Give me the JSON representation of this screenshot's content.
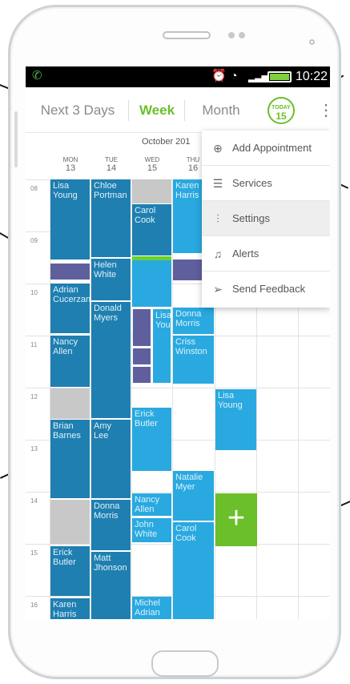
{
  "status_bar": {
    "time": "10:22"
  },
  "tabs": [
    {
      "label": "Next 3 Days"
    },
    {
      "label": "Week"
    },
    {
      "label": "Month"
    }
  ],
  "today_badge": {
    "label": "TODAY",
    "day": "15"
  },
  "calendar": {
    "month_label": "October 201",
    "days": [
      {
        "dow": "MON",
        "num": "13"
      },
      {
        "dow": "TUE",
        "num": "14"
      },
      {
        "dow": "WED",
        "num": "15"
      },
      {
        "dow": "THU",
        "num": "16"
      }
    ],
    "hours": [
      "08",
      "09",
      "10",
      "11",
      "12",
      "13",
      "14",
      "15",
      "16"
    ],
    "events": {
      "lisa_young_mon": "Lisa Young",
      "adrian": "Adrian Cucerzan",
      "nancy_allen_mon": "Nancy Allen",
      "brian": "Brian Barnes",
      "erick_mon": "Erick Butler",
      "karen_mon": "Karen Harris",
      "chloe": "Chloe Portman",
      "helen": "Helen White",
      "donald": "Donald Myers",
      "amy": "Amy Lee",
      "donna_tue": "Donna Morris",
      "matt": "Matt Jhonson",
      "carol_wed": "Carol Cook",
      "lisa_young_wed": "Lisa Young",
      "erick_wed": "Erick Butler",
      "nancy_wed": "Nancy Allen",
      "john": "John White",
      "michel": "Michel Adrian",
      "karen_thu": "Karen Harris",
      "donna_thu": "Donna Morris",
      "criss": "Criss Winston",
      "natalie": "Natalie Myer",
      "carol_thu": "Carol Cook",
      "lisa_young_fri": "Lisa Young"
    }
  },
  "overflow_menu": [
    {
      "icon": "plus-circle-icon",
      "label": "Add Appointment"
    },
    {
      "icon": "list-icon",
      "label": "Services"
    },
    {
      "icon": "sliders-icon",
      "label": "Settings"
    },
    {
      "icon": "bell-icon",
      "label": "Alerts"
    },
    {
      "icon": "send-icon",
      "label": "Send Feedback"
    }
  ],
  "colors": {
    "accent": "#6bbf2a",
    "dark_event": "#1f7fb0",
    "light_event": "#29a9e0",
    "purple_event": "#5f5f9e"
  }
}
